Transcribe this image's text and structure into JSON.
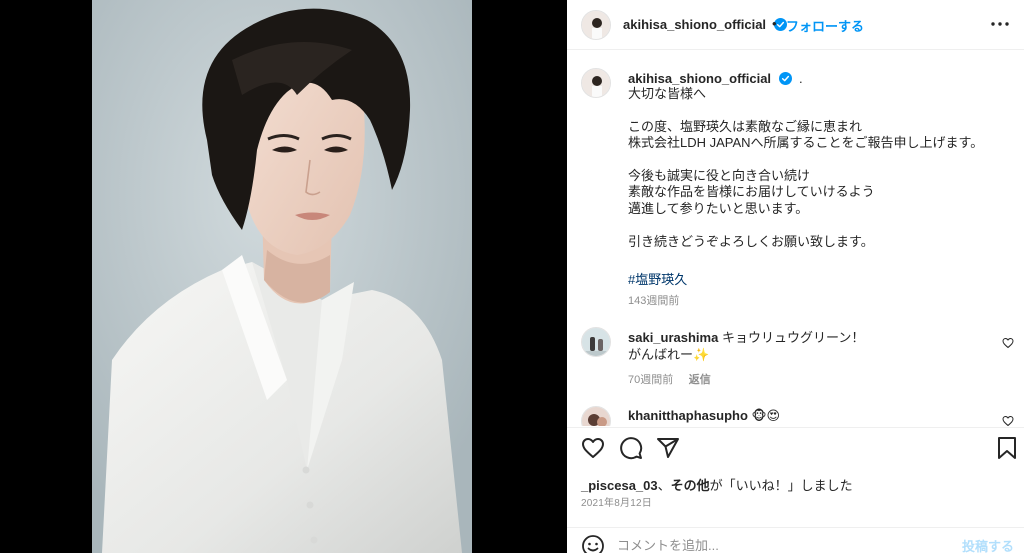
{
  "post": {
    "username": "akihisa_shiono_official",
    "follow_label": "フォローする",
    "dot": "•"
  },
  "caption": {
    "username": "akihisa_shiono_official",
    "dot": ".",
    "text": "大切な皆様へ\n\nこの度、塩野瑛久は素敵なご縁に恵まれ\n株式会社LDH JAPANへ所属することをご報告申し上げます。\n\n今後も誠実に役と向き合い続け\n素敵な作品を皆様にお届けしていけるよう\n邁進して参りたいと思います。\n\n引き続きどうぞよろしくお願い致します。",
    "hashtag": "#塩野瑛久",
    "age": "143週間前"
  },
  "comments": [
    {
      "username": "saki_urashima",
      "text_line1": "キョウリュウグリーン！",
      "text_line2": "がんばれー✨",
      "age": "70週間前",
      "reply_label": "返信"
    },
    {
      "username": "khanitthaphasupho",
      "text": "🐵😍"
    }
  ],
  "likes": {
    "user": "_piscesa_03",
    "separator": "、",
    "others": "その他",
    "suffix": "が「いいね！」しました"
  },
  "date": "2021年8月12日",
  "add_comment": {
    "placeholder": "コメントを追加...",
    "post_label": "投稿する"
  },
  "colors": {
    "accent": "#0095f6",
    "hashtag": "#00376b",
    "muted": "#8e8e8e"
  },
  "icons": [
    "more-options-icon",
    "verified-badge-icon",
    "heart-icon",
    "comment-icon",
    "share-icon",
    "bookmark-icon",
    "emoji-icon"
  ]
}
